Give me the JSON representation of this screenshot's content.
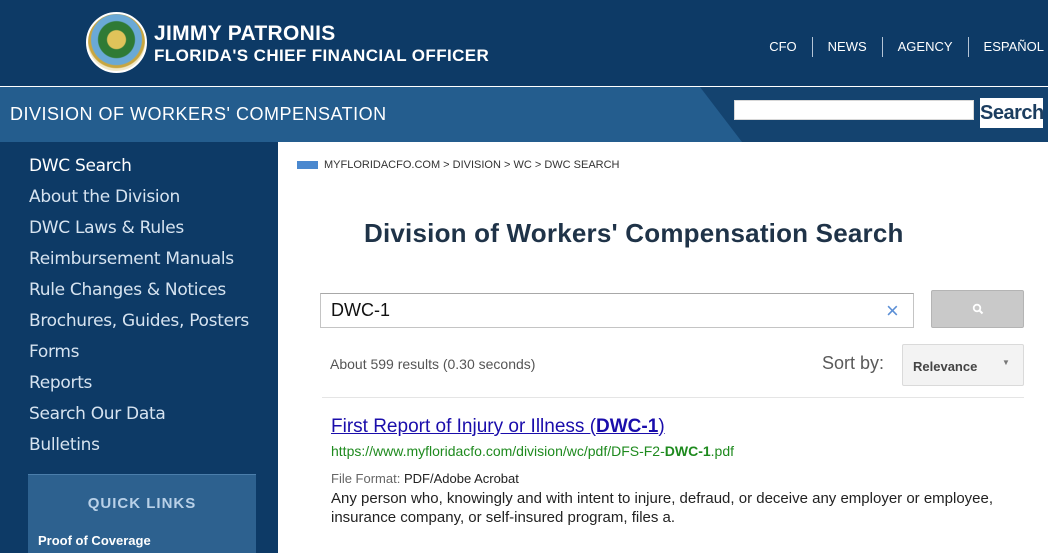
{
  "header": {
    "cfo_name": "JIMMY PATRONIS",
    "cfo_title": "FLORIDA'S CHIEF FINANCIAL OFFICER",
    "nav": [
      "CFO",
      "NEWS",
      "AGENCY",
      "ESPAÑOL"
    ]
  },
  "division_bar": {
    "title": "DIVISION OF WORKERS' COMPENSATION",
    "search_value": "",
    "search_button": "Search"
  },
  "sidebar": {
    "items": [
      "DWC Search",
      "About the Division",
      "DWC Laws & Rules",
      "Reimbursement Manuals",
      "Rule Changes & Notices",
      "Brochures, Guides, Posters",
      "Forms",
      "Reports",
      "Search Our Data",
      "Bulletins"
    ],
    "quick_links_title": "QUICK LINKS",
    "quick_links": [
      "Proof of Coverage"
    ]
  },
  "breadcrumb": "MYFLORIDACFO.COM > DIVISION > WC > DWC SEARCH",
  "page_title": "Division of Workers' Compensation Search",
  "search": {
    "query": "DWC-1",
    "clear_glyph": "×",
    "result_count": "About 599 results (0.30 seconds)",
    "sort_label": "Sort by:",
    "sort_value": "Relevance"
  },
  "result": {
    "title_prefix": "First Report of Injury or Illness (",
    "title_highlight": "DWC-1",
    "title_suffix": ")",
    "url_prefix": "https://www.myfloridacfo.com/division/wc/pdf/DFS-F2-",
    "url_highlight": "DWC-1",
    "url_suffix": ".pdf",
    "format_label": "File Format:",
    "format_value": "PDF/Adobe Acrobat",
    "snippet": "Any person who, knowingly and with intent to injure, defraud, or deceive any employer or employee, insurance company, or self-insured program, files a."
  },
  "colors": {
    "header_navy": "#0d3a66",
    "division_blue": "#245d8e",
    "link_blue": "#1a0dab",
    "url_green": "#1e8a1e"
  }
}
